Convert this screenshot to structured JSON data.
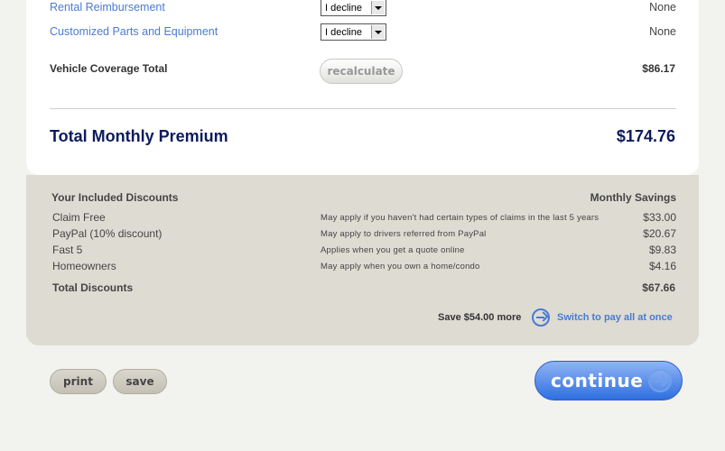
{
  "coverage": {
    "rows": [
      {
        "label": "Rental Reimbursement",
        "select_value": "I decline",
        "amount": "None"
      },
      {
        "label": "Customized Parts and Equipment",
        "select_value": "I decline",
        "amount": "None"
      }
    ],
    "total_label": "Vehicle Coverage Total",
    "recalculate_label": "recalculate",
    "total_amount": "$86.17"
  },
  "premium": {
    "label": "Total Monthly Premium",
    "amount": "$174.76"
  },
  "discounts": {
    "header_left": "Your Included Discounts",
    "header_right": "Monthly Savings",
    "items": [
      {
        "name": "Claim Free",
        "desc": "May apply if you haven't had certain types of claims in the last 5 years",
        "saving": "$33.00"
      },
      {
        "name": "PayPal (10% discount)",
        "desc": "May apply to drivers referred from PayPal",
        "saving": "$20.67"
      },
      {
        "name": "Fast 5",
        "desc": "Applies when you get a quote online",
        "saving": "$9.83"
      },
      {
        "name": "Homeowners",
        "desc": "May apply when you own a home/condo",
        "saving": "$4.16"
      }
    ],
    "total_label": "Total Discounts",
    "total_amount": "$67.66",
    "save_more": "Save $54.00 more",
    "switch_link": "Switch to pay all at once"
  },
  "buttons": {
    "print": "print",
    "save": "save",
    "continue": "continue"
  },
  "colors": {
    "link": "#4a7bd0",
    "premium_text": "#0c1b5c",
    "discount_panel": "#dedbd3",
    "continue_button": "#2f6fe0"
  }
}
